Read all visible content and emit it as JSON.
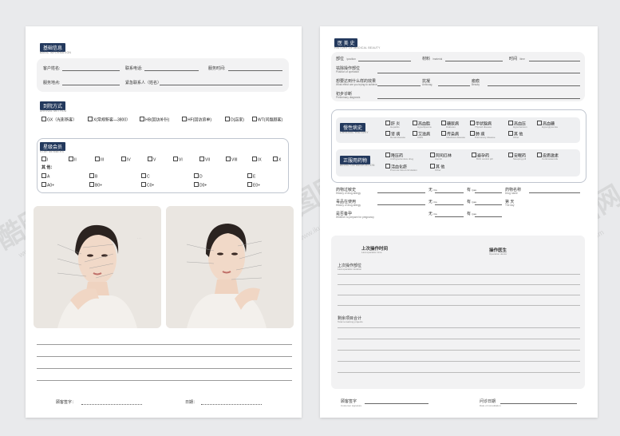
{
  "left": {
    "basic": {
      "tag": "基础信息",
      "sub": "BASIC INFORMATION",
      "fields": [
        "客户姓名:",
        "联系电话:",
        "服务时间:",
        "服务地点:",
        "紧急联系人（姓名）"
      ]
    },
    "arrival": {
      "tag": "到院方式",
      "sub": "ARRIVAL METHOD",
      "options": [
        "GX（光影新客）",
        "X(常规新客—3800）",
        "HB(回访补针)",
        "HF(回访追单)",
        "D(店家)",
        "WT(问题顾客)"
      ]
    },
    "star": {
      "tag": "星级会员",
      "sub": "STAR MEMBERS",
      "row1": [
        "I",
        "II",
        "III",
        "IV",
        "V",
        "VI",
        "VII",
        "VIII",
        "IX",
        "X"
      ],
      "extra": "其 他：",
      "row2": [
        "A",
        "B",
        "C",
        "D",
        "E"
      ],
      "row3": [
        "A0+",
        "B0+",
        "C0+",
        "D0+",
        "E0+"
      ]
    },
    "footer": {
      "signature": "顾客签字：",
      "date": "日期："
    }
  },
  "right": {
    "history": {
      "tag": "医 美 史",
      "sub": "HISTORY OF MEDICAL BEAUTY",
      "part": "部位",
      "part_en": "/position",
      "material": "材料",
      "material_en": "/material",
      "time": "时间",
      "time_en": "/time",
      "q1": "祛除操作部位",
      "q1_en": "Position of operation",
      "q2": "想要达到什么样的效果",
      "q2_en": "What effect are you trying to achieve",
      "coag": "抗凝",
      "coag_en": "Anticoag",
      "scar": "瘢痕",
      "scar_en": "Beauty",
      "q3": "初步诊断",
      "q3_en": "Preliminary diagnosis"
    },
    "chronic": {
      "tag": "慢性病史",
      "sub": "CHRONIC HISTORY",
      "items": [
        [
          "肝 炎",
          "Hepatitis"
        ],
        [
          "高血脂",
          "Hyperlipemia"
        ],
        [
          "糖尿病",
          "Diabetes"
        ],
        [
          "甲状腺病",
          "Thyroid disease"
        ],
        [
          "高血压",
          "Hypertension"
        ],
        [
          "高血糖",
          "Hyperglycemia"
        ],
        [
          "肾 病",
          "Renal disease"
        ],
        [
          "艾滋病",
          "AIDS"
        ],
        [
          "传染病",
          "Infectious disease"
        ],
        [
          "肺 病",
          "Pulmonary disease"
        ],
        [
          "其 他",
          "Other"
        ]
      ]
    },
    "medication": {
      "tag": "正服用药物",
      "sub": "BEING ON MEDICATION",
      "items": [
        [
          "降压药",
          "Antihypertensive drug"
        ],
        [
          "阿司匹林",
          "Aspirin"
        ],
        [
          "避孕药",
          "Birth control pill"
        ],
        [
          "安眠药",
          "Sleeping pill"
        ],
        [
          "皮质激素",
          "Corticosteroids"
        ],
        [
          "活血化瘀",
          "Promote blood circulation"
        ],
        [
          "其 他",
          "Other"
        ]
      ]
    },
    "allergy": {
      "q1": "药物过敏史",
      "q1_en": "History of drug allergy",
      "q2": "毒品在使用",
      "q2_en": "History of drug allergy",
      "q3": "是否备孕",
      "q3_en": "Whether to prepare for pregnancy",
      "none": "无",
      "none_en": "/no",
      "yes": "有",
      "yes_en": "/yes",
      "drug": "药物名称",
      "drug_en": "Drug name",
      "day": "第     天",
      "day_en": "The day"
    },
    "operation": {
      "last_time": "上次操作时间",
      "last_time_en": "Last operation time",
      "doctor": "操作医生",
      "doctor_en": "Operation doctor",
      "last_part": "上次操作部位",
      "last_part_en": "Last operation location",
      "remaining": "剩余项目合计",
      "remaining_en": "Total remaining projects"
    },
    "footer": {
      "signature": "顾客签字",
      "signature_en": "Customer signature",
      "date": "问诊日期",
      "date_en": "Date of consultation"
    }
  },
  "watermark": {
    "brand": "酷图网",
    "url": "www.ikutu.com"
  }
}
